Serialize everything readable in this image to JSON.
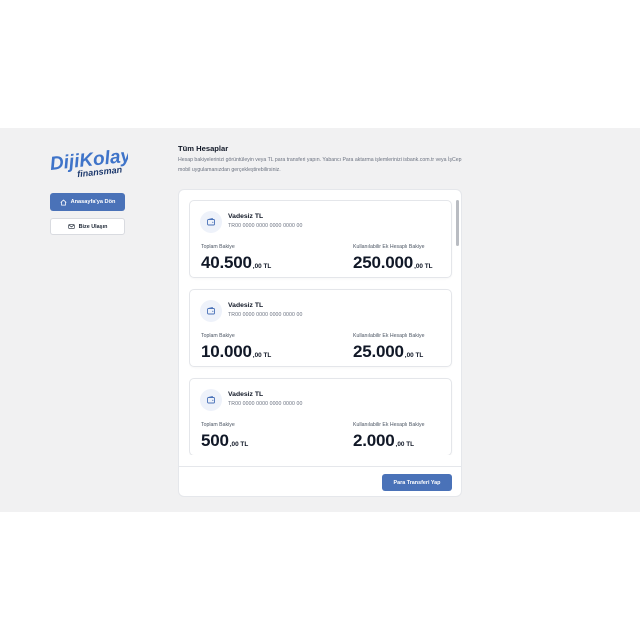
{
  "brand": {
    "logo_main": "DijiKolay",
    "logo_sub": "finansman",
    "logo_color": "#3f74c9"
  },
  "sidebar": {
    "home_button": {
      "label": "Anasayfa'ya Dön",
      "icon": "home-icon"
    },
    "contact_button": {
      "label": "Bize Ulaşın",
      "icon": "mail-icon"
    }
  },
  "header": {
    "title": "Tüm Hesaplar",
    "description": "Hesap bakiyelerinizi görüntüleyin veya TL para transferi yapın. Yabancı Para aktarma işlemlerinizi isbank.com.tr veya İşCep mobil uygulamanızdan gerçekleştirebilirsiniz."
  },
  "accounts": [
    {
      "name": "Vadesiz TL",
      "iban": "TR00 0000 0000 0000 0000 00",
      "balance_label": "Toplam Bakiye",
      "balance_int": "40.500",
      "balance_dec": ",00 TL",
      "credit_label": "Kullanılabilir Ek Hesaplı Bakiye",
      "credit_int": "250.000",
      "credit_dec": ",00 TL"
    },
    {
      "name": "Vadesiz TL",
      "iban": "TR00 0000 0000 0000 0000 00",
      "balance_label": "Toplam Bakiye",
      "balance_int": "10.000",
      "balance_dec": ",00 TL",
      "credit_label": "Kullanılabilir Ek Hesaplı Bakiye",
      "credit_int": "25.000",
      "credit_dec": ",00 TL"
    },
    {
      "name": "Vadesiz TL",
      "iban": "TR00 0000 0000 0000 0000 00",
      "balance_label": "Toplam Bakiye",
      "balance_int": "500",
      "balance_dec": ",00 TL",
      "credit_label": "Kullanılabilir Ek Hesaplı Bakiye",
      "credit_int": "2.000",
      "credit_dec": ",00 TL"
    }
  ],
  "footer": {
    "transfer_button": "Para Transferi Yap"
  },
  "colors": {
    "accent": "#4a72b8",
    "background": "#f1f1f2",
    "panel": "#ffffff"
  }
}
